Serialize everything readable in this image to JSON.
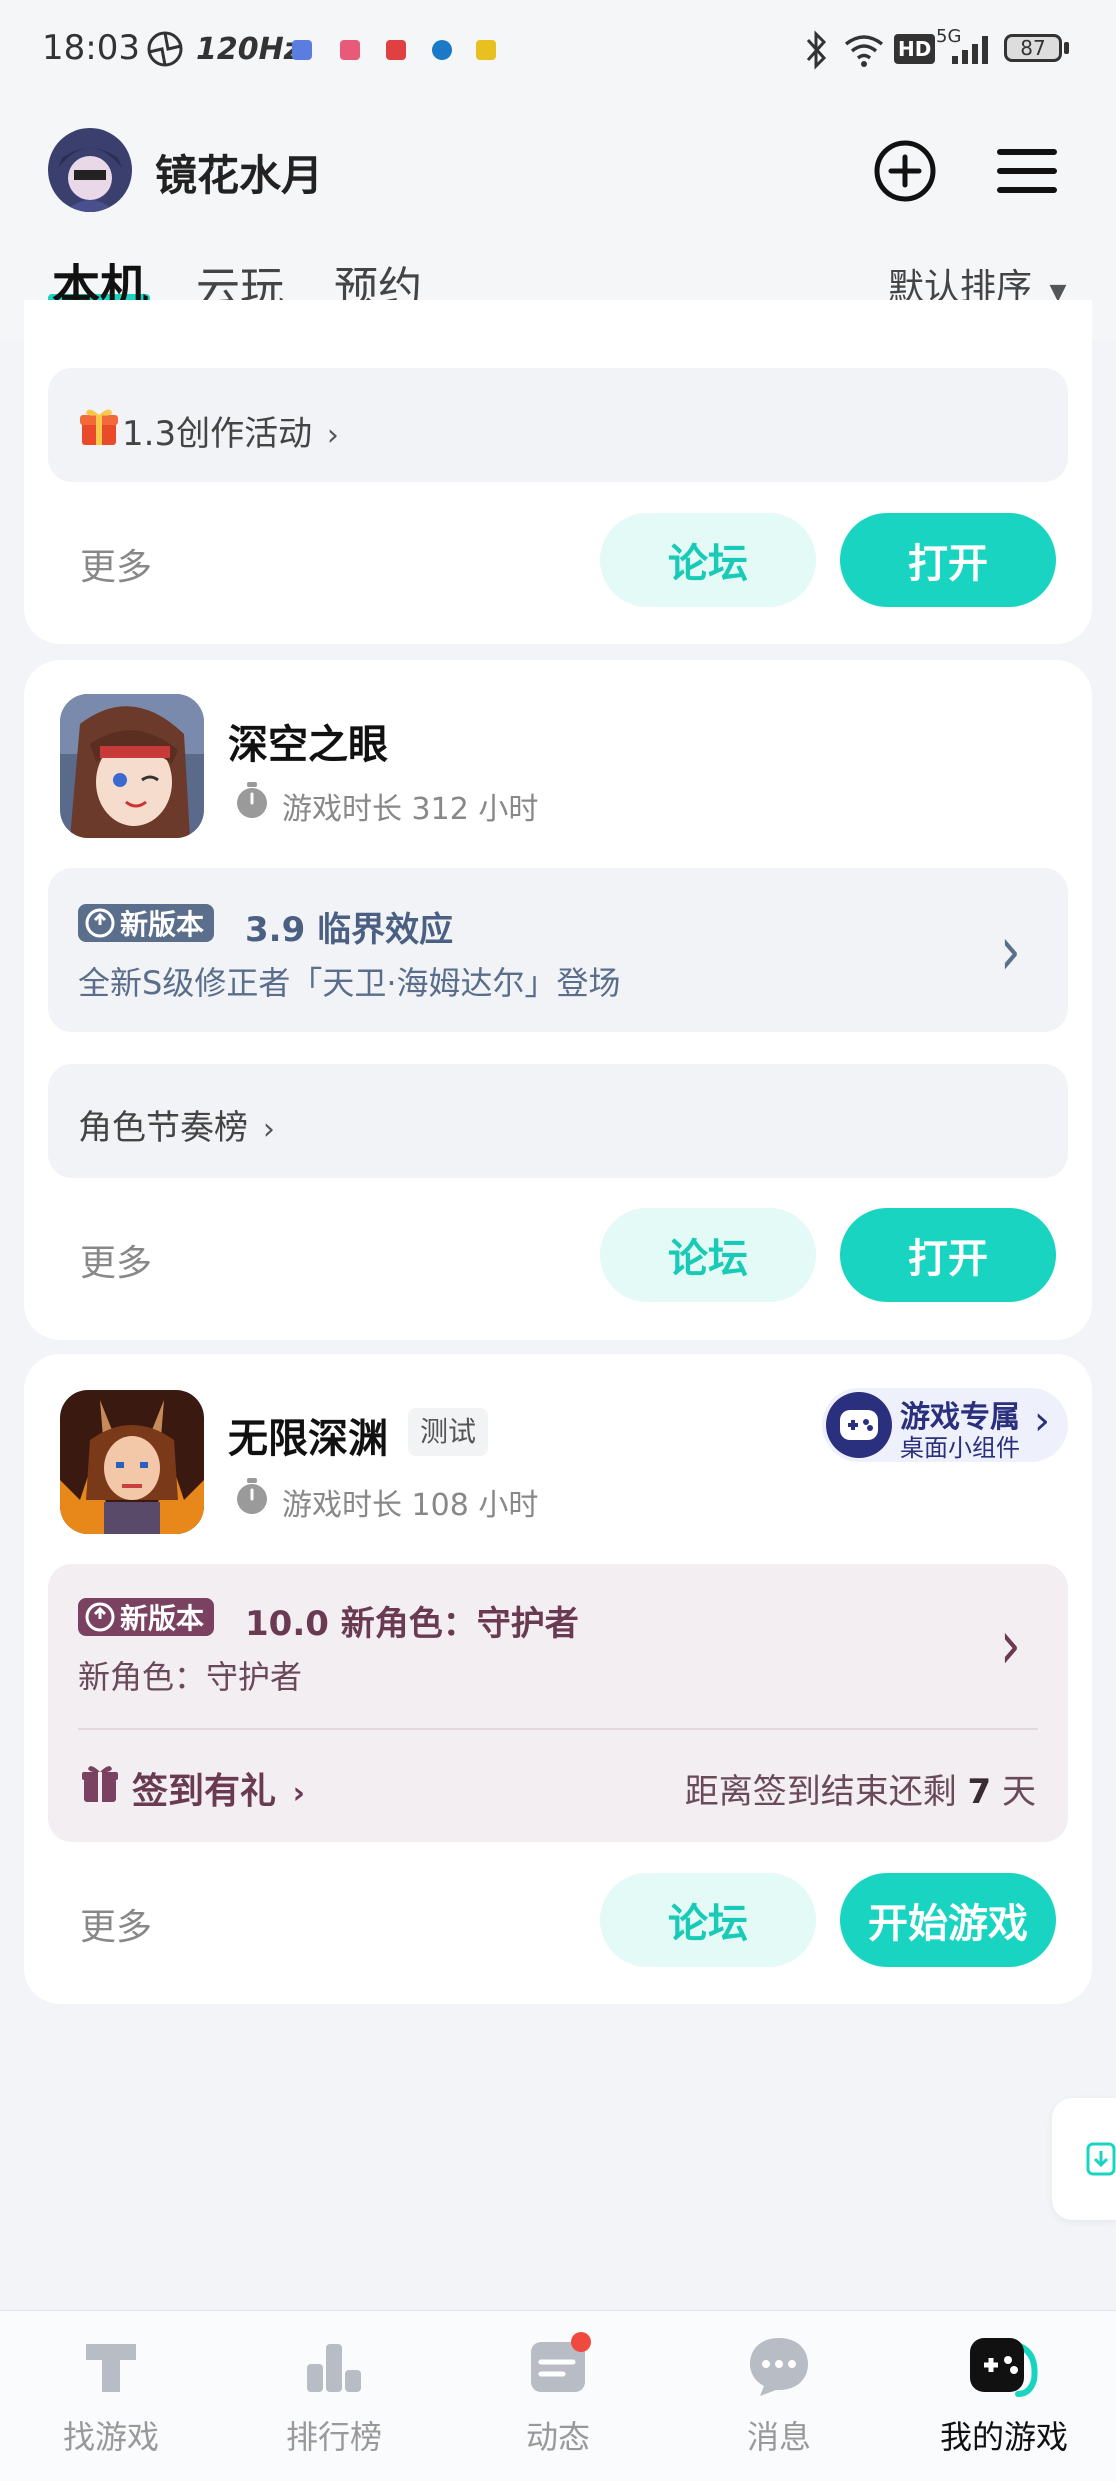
{
  "status_bar": {
    "time": "18:03",
    "refresh_rate": "120Hz",
    "network": "5G",
    "hd": "HD",
    "battery": "87"
  },
  "header": {
    "username": "镜花水月",
    "tabs": [
      "本机",
      "云玩",
      "预约"
    ],
    "sort_label": "默认排序"
  },
  "card_top": {
    "activity": "1.3创作活动",
    "more": "更多",
    "forum": "论坛",
    "open": "打开"
  },
  "card_shenkong": {
    "name": "深空之眼",
    "playtime": "游戏时长 312 小时",
    "badge": "新版本",
    "version_title": "3.9 临界效应",
    "version_desc": "全新S级修正者「天卫·海姆达尔」登场",
    "rank_link": "角色节奏榜",
    "more": "更多",
    "forum": "论坛",
    "open": "打开"
  },
  "card_wuxian": {
    "name": "无限深渊",
    "tag": "测试",
    "playtime": "游戏时长 108 小时",
    "widget_title": "游戏专属",
    "widget_sub": "桌面小组件",
    "badge": "新版本",
    "version_title": "10.0 新角色：守护者",
    "version_desc": "新角色：守护者",
    "checkin": "签到有礼",
    "checkin_prefix": "距离签到结束还剩",
    "checkin_days": "7",
    "checkin_unit": "天",
    "more": "更多",
    "forum": "论坛",
    "start": "开始游戏"
  },
  "bottom_nav": [
    {
      "label": "找游戏",
      "icon": "find-game-icon"
    },
    {
      "label": "排行榜",
      "icon": "ranking-icon"
    },
    {
      "label": "动态",
      "icon": "feed-icon"
    },
    {
      "label": "消息",
      "icon": "message-icon"
    },
    {
      "label": "我的游戏",
      "icon": "my-games-icon"
    }
  ],
  "colors": {
    "accent": "#19d4c0",
    "accent_light": "#e3faf6",
    "badge_blue": "#5b6f8d",
    "badge_maroon": "#7a4260"
  }
}
